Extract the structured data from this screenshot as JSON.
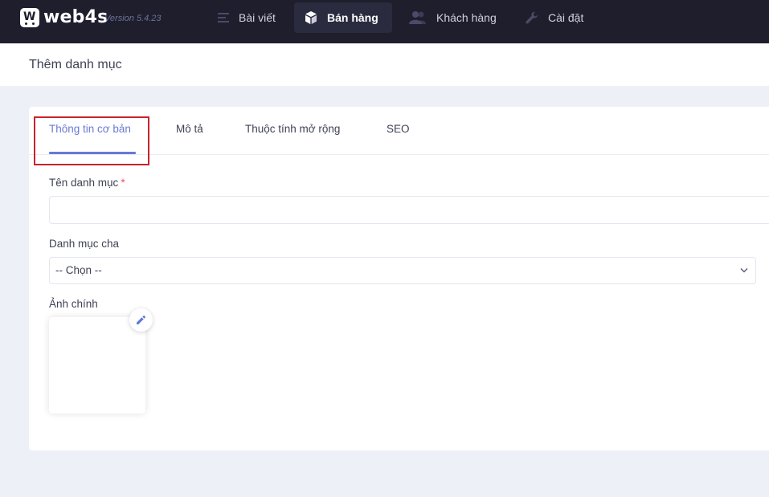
{
  "header": {
    "brand": "web4s",
    "logo_letter": "W",
    "version": "Version 5.4.23",
    "nav": [
      {
        "label": "Bài viết",
        "icon": "menu-lines-icon",
        "active": false
      },
      {
        "label": "Bán hàng",
        "icon": "box-icon",
        "active": true
      },
      {
        "label": "Khách hàng",
        "icon": "users-icon",
        "active": false
      },
      {
        "label": "Cài đặt",
        "icon": "wrench-icon",
        "active": false
      }
    ]
  },
  "page": {
    "title": "Thêm danh mục"
  },
  "tabs": [
    {
      "label": "Thông tin cơ bản",
      "active": true
    },
    {
      "label": "Mô tả",
      "active": false
    },
    {
      "label": "Thuộc tính mở rộng",
      "active": false
    },
    {
      "label": "SEO",
      "active": false
    }
  ],
  "form": {
    "name_label": "Tên danh mục",
    "required_mark": "*",
    "name_value": "",
    "parent_label": "Danh mục cha",
    "parent_selected": "-- Chọn --",
    "image_label": "Ảnh chính"
  },
  "colors": {
    "navbar": "#1e1e2d",
    "accent": "#6979d6",
    "highlight": "#c8232c",
    "required": "#f64e60"
  }
}
